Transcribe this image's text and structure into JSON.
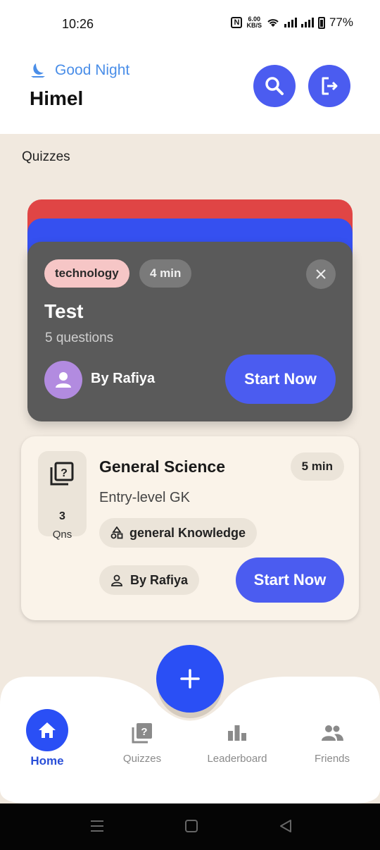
{
  "status": {
    "time": "10:26",
    "speed_value": "6.00",
    "speed_unit": "KB/S",
    "battery": "77%"
  },
  "header": {
    "greeting": "Good Night",
    "user": "Himel",
    "icons": [
      "moon-icon",
      "search-icon",
      "logout-icon"
    ]
  },
  "section": {
    "title": "Quizzes"
  },
  "featured_quiz": {
    "category": "technology",
    "duration": "4 min",
    "title": "Test",
    "questions": "5 questions",
    "author": "By Rafiya",
    "start_label": "Start Now"
  },
  "quiz_card": {
    "title": "General Science",
    "duration": "5 min",
    "subtitle": "Entry-level GK",
    "question_count": "3",
    "question_unit": "Qns",
    "category": "general Knowledge",
    "author": "By Rafiya",
    "start_label": "Start Now"
  },
  "nav": {
    "items": [
      {
        "label": "Home",
        "icon": "home-icon",
        "active": true
      },
      {
        "label": "Quizzes",
        "icon": "quiz-icon",
        "active": false
      },
      {
        "label": "Leaderboard",
        "icon": "leaderboard-icon",
        "active": false
      },
      {
        "label": "Friends",
        "icon": "friends-icon",
        "active": false
      }
    ]
  },
  "colors": {
    "accent": "#4b5cf0",
    "fab": "#2a4ff5",
    "background": "#f1e9df",
    "card_dark": "#5a5a5a",
    "stack_red": "#e04545",
    "stack_blue": "#3550f0",
    "greeting": "#4a8ee8"
  }
}
